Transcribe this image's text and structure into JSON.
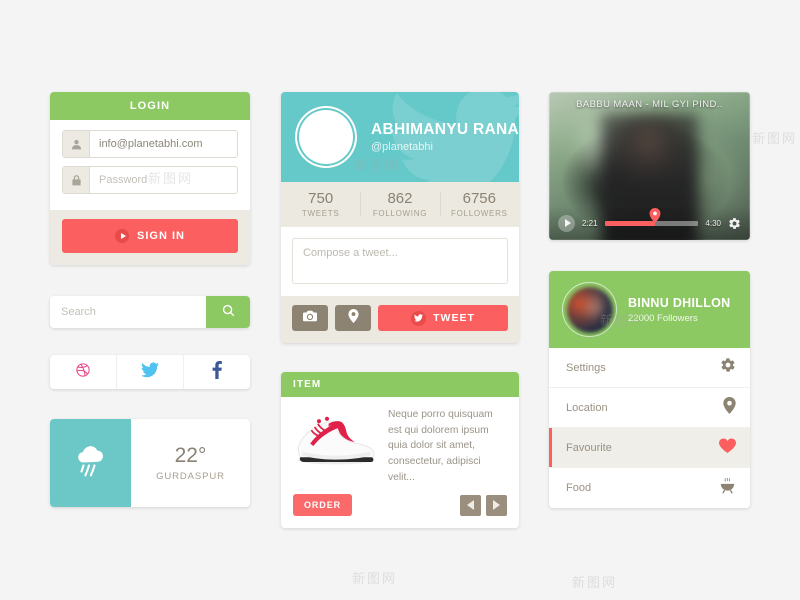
{
  "theme": {
    "background": "#f4f4f4",
    "green": "#8dc963",
    "teal": "#65c8c9",
    "red": "#fb5f5f",
    "brown": "#8d8372",
    "cream": "#ece9e0"
  },
  "login": {
    "title": "LOGIN",
    "email_value": "info@planetabhi.com",
    "password_placeholder": "Password",
    "submit_label": "SIGN IN",
    "user_icon": "user-icon",
    "lock_icon": "lock-icon",
    "play_icon": "play-icon"
  },
  "search": {
    "placeholder": "Search",
    "value": "",
    "icon": "search-icon"
  },
  "social": {
    "items": [
      {
        "name": "dribbble",
        "icon": "dribbble-icon",
        "color": "#ec4989"
      },
      {
        "name": "twitter",
        "icon": "twitter-icon",
        "color": "#4fc2f0"
      },
      {
        "name": "facebook",
        "icon": "facebook-icon",
        "color": "#3b5998"
      }
    ]
  },
  "weather": {
    "icon": "rain-cloud-icon",
    "temperature": "22°",
    "city": "GURDASPUR"
  },
  "twitter": {
    "display_name": "ABHIMANYU RANA",
    "handle": "@planetabhi",
    "avatar": "avatar",
    "bird_icon": "twitter-bird-icon",
    "stats": [
      {
        "value": "750",
        "label": "TWEETS"
      },
      {
        "value": "862",
        "label": "FOLLOWING"
      },
      {
        "value": "6756",
        "label": "FOLLOWERS"
      }
    ],
    "compose_placeholder": "Compose a tweet...",
    "compose_value": "",
    "camera_icon": "camera-icon",
    "location_icon": "location-pin-icon",
    "tweet_label": "TWEET",
    "tweet_icon": "twitter-bird-icon"
  },
  "item": {
    "header": "ITEM",
    "image": "sneaker-image",
    "description": "Neque porro quisquam est qui dolorem ipsum quia dolor sit amet, consectetur, adipisci velit...",
    "order_label": "ORDER",
    "prev_icon": "chevron-left-icon",
    "next_icon": "chevron-right-icon"
  },
  "video": {
    "title": "BABBU MAAN - MIL GYI PIND..",
    "play_icon": "play-icon",
    "current_time": "2:21",
    "total_time": "4:30",
    "progress_percent": 54,
    "settings_icon": "gear-icon",
    "knob_icon": "location-pin-icon"
  },
  "profile_menu": {
    "name": "BINNU DHILLON",
    "followers": "22000 Followers",
    "avatar": "avatar",
    "items": [
      {
        "label": "Settings",
        "icon": "gear-icon",
        "active": false
      },
      {
        "label": "Location",
        "icon": "location-pin-icon",
        "active": false
      },
      {
        "label": "Favourite",
        "icon": "heart-icon",
        "active": true
      },
      {
        "label": "Food",
        "icon": "grill-icon",
        "active": false
      }
    ]
  },
  "watermarks": [
    "新图网",
    "新图网",
    "新图网",
    "新图网",
    "新图网",
    "新图网"
  ]
}
